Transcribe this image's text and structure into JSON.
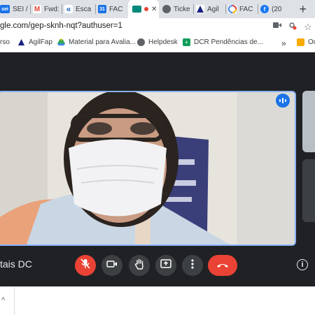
{
  "tabs": [
    {
      "label": "SEI /",
      "icon": "sei-icon",
      "fav_text": "sei",
      "fav_color": "#1a73e8"
    },
    {
      "label": "Fwd:",
      "icon": "gmail-icon",
      "fav_text": "M",
      "fav_color": "#ea4335"
    },
    {
      "label": "Esca",
      "icon": "double-arrow-icon",
      "fav_text": "«",
      "fav_color": "#1565c0"
    },
    {
      "label": "FAC",
      "icon": "calendar-icon",
      "fav_text": "31",
      "fav_color": "#1a73e8"
    },
    {
      "label": "",
      "icon": "meet-icon",
      "fav_text": "",
      "fav_color": "#00897b",
      "active": true,
      "close": "✕"
    },
    {
      "label": "Ticke",
      "icon": "globe-icon",
      "fav_text": "",
      "fav_color": "#5f6368"
    },
    {
      "label": "Agil",
      "icon": "agil-icon",
      "fav_text": "",
      "fav_color": "#1a237e"
    },
    {
      "label": "FAC",
      "icon": "drive-icon",
      "fav_text": "",
      "fav_color": "#fbbc04"
    },
    {
      "label": "(20",
      "icon": "facebook-icon",
      "fav_text": "f",
      "fav_color": "#1877f2"
    }
  ],
  "new_tab": "+",
  "address": {
    "url": "gle.com/gep-sknh-nqt?authuser=1"
  },
  "bookmarks": [
    {
      "label": "rso"
    },
    {
      "label": "AgilFap",
      "icon": "agil-icon"
    },
    {
      "label": "Material para Avalia...",
      "icon": "drive-icon"
    },
    {
      "label": "Helpdesk",
      "icon": "globe-icon"
    },
    {
      "label": "DCR Pendências de...",
      "icon": "sheets-icon"
    },
    {
      "label": "»"
    },
    {
      "label": "Ou",
      "icon": "folder-icon"
    }
  ],
  "meeting": {
    "participant_name": "tais DC",
    "controls": {
      "mic": "mic-off",
      "camera": "camera",
      "raise_hand": "hand",
      "present": "present-screen",
      "more": "more-options",
      "hangup": "end-call"
    },
    "info": "i"
  },
  "colors": {
    "accent": "#8ab4f8",
    "danger": "#ea4335",
    "dark_bg": "#202124",
    "control_bg": "#3c4043"
  }
}
